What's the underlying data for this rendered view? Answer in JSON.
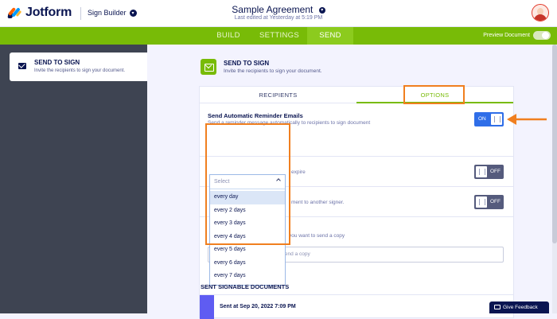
{
  "brand": {
    "name": "Jotform",
    "accent": "#78bb07",
    "highlight": "#f07f1f"
  },
  "header": {
    "builder_label": "Sign Builder",
    "doc_title": "Sample Agreement",
    "last_edited": "Last edited at Yesterday at 5:19 PM"
  },
  "nav": {
    "tabs": [
      {
        "label": "BUILD"
      },
      {
        "label": "SETTINGS"
      },
      {
        "label": "SEND",
        "active": true
      }
    ],
    "preview_label": "Preview Document"
  },
  "sidebar": {
    "title": "SEND TO SIGN",
    "desc": "Invite the recipients to sign your document."
  },
  "main": {
    "title": "SEND TO SIGN",
    "desc": "Invite the recipients to sign your document.",
    "tabs": [
      {
        "label": "RECIPIENTS"
      },
      {
        "label": "OPTIONS",
        "active": true
      }
    ],
    "reminder": {
      "title": "Send Automatic Reminder Emails",
      "desc": "Send a reminder message automatically to recipients to sign document",
      "toggle": "ON"
    },
    "row2": {
      "text": "expire",
      "toggle": "OFF"
    },
    "row3": {
      "text": "ment to another signer.",
      "toggle": "OFF"
    },
    "row4": {
      "text": "you want to send a copy"
    },
    "email_placeholder": "Enter the email address to send a copy",
    "dropdown": {
      "placeholder": "Select",
      "options": [
        "every day",
        "every 2 days",
        "every 3 days",
        "every 4 days",
        "every 5 days",
        "every 6 days",
        "every 7 days"
      ],
      "selected_index": 0
    }
  },
  "sent": {
    "title": "SENT SIGNABLE DOCUMENTS",
    "first_item": "Sent at Sep 20, 2022 7:09 PM"
  },
  "feedback_label": "Give Feedback"
}
